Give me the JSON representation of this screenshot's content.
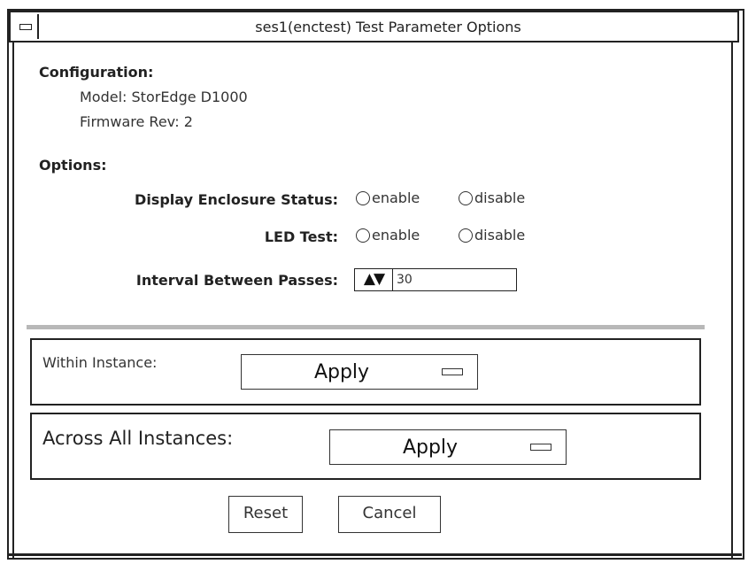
{
  "window": {
    "title": "ses1(enctest) Test Parameter Options"
  },
  "configuration": {
    "heading": "Configuration:",
    "model": "Model: StorEdge D1000",
    "firmware": "Firmware Rev: 2"
  },
  "options": {
    "heading": "Options:",
    "display_enclosure_status": {
      "label": "Display Enclosure Status:",
      "enable_label": "enable",
      "disable_label": "disable"
    },
    "led_test": {
      "label": "LED Test:",
      "enable_label": "enable",
      "disable_label": "disable"
    },
    "interval": {
      "label": "Interval Between Passes:",
      "stepper_glyph": "▲▼",
      "value": "30"
    }
  },
  "within_instance": {
    "label": "Within Instance:",
    "button_label": "Apply"
  },
  "across_all_instances": {
    "label": "Across All Instances:",
    "button_label": "Apply"
  },
  "buttons": {
    "reset": "Reset",
    "cancel": "Cancel"
  },
  "icons": {
    "window_menu": "window-menu-icon",
    "radio": "radio-button-icon",
    "stepper": "up-down-arrows-icon",
    "menu_mark": "menu-indicator-icon"
  }
}
